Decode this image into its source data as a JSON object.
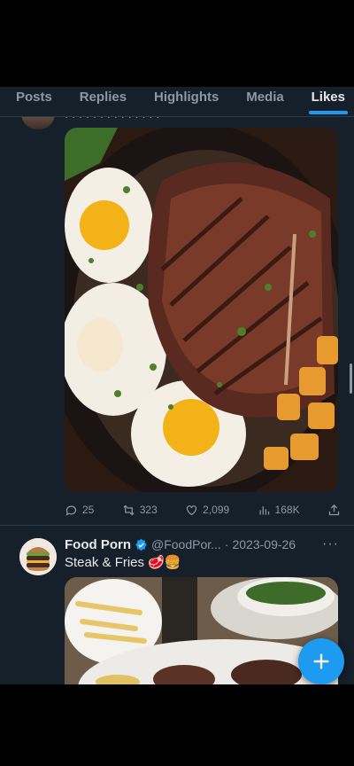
{
  "tabs": [
    {
      "label": "Posts"
    },
    {
      "label": "Replies"
    },
    {
      "label": "Highlights"
    },
    {
      "label": "Media"
    },
    {
      "label": "Likes",
      "active": true
    }
  ],
  "previous_post": {
    "text_fragment": "· · · · · · · · · · · · · ·"
  },
  "first_post": {
    "stats": {
      "replies": "25",
      "reposts": "323",
      "likes": "2,099",
      "views": "168K"
    }
  },
  "second_post": {
    "name": "Food Porn",
    "handle": "@FoodPor...",
    "separator": "·",
    "date": "2023-09-26",
    "text": "Steak & Fries 🥩🍔"
  },
  "colors": {
    "background": "#15202b",
    "accent": "#1d9bf0",
    "muted": "#8b98a5"
  },
  "icons": [
    "reply-icon",
    "repost-icon",
    "like-icon",
    "views-icon",
    "share-icon",
    "verified-icon",
    "more-icon",
    "compose-plus-icon"
  ]
}
